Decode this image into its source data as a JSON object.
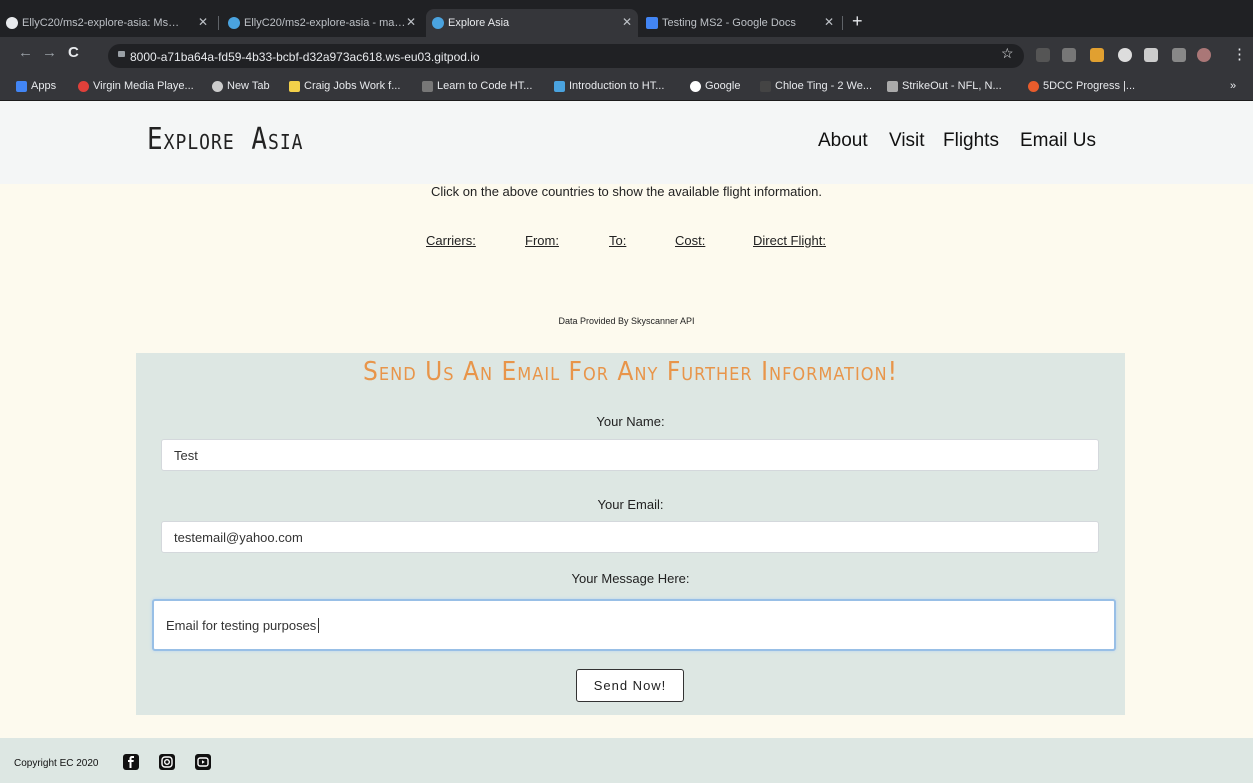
{
  "browser": {
    "tabs": [
      {
        "label": "EllyC20/ms2-explore-asia: Ms…",
        "icon": "github-icon"
      },
      {
        "label": "EllyC20/ms2-explore-asia - ma…",
        "icon": "gitpod-icon"
      },
      {
        "label": "Explore Asia",
        "icon": "gitpod-icon",
        "active": true
      },
      {
        "label": "Testing MS2 - Google Docs",
        "icon": "docs-icon"
      }
    ],
    "new_tab": "+",
    "url": "8000-a71ba64a-fd59-4b33-bcbf-d32a973ac618.ws-eu03.gitpod.io",
    "bookmarks": [
      "Apps",
      "Virgin Media Playe...",
      "New Tab",
      "Craig Jobs Work f...",
      "Learn to Code HT...",
      "Introduction to HT...",
      "Google",
      "Chloe Ting - 2 We...",
      "StrikeOut - NFL, N...",
      "5DCC Progress |..."
    ],
    "more_bookmarks": "»"
  },
  "header": {
    "logo": "Explore Asia",
    "nav": [
      "About",
      "Visit",
      "Flights",
      "Email Us"
    ]
  },
  "flights": {
    "instruction": "Click on the above countries to show the available flight information.",
    "columns": [
      "Carriers:",
      "From:",
      "To:",
      "Cost:",
      "Direct Flight:"
    ],
    "attribution": "Data Provided By Skyscanner API"
  },
  "contact": {
    "title": "Send Us An Email For Any Further Information!",
    "name_label": "Your Name:",
    "name_value": "Test",
    "email_label": "Your Email:",
    "email_value": "testemail@yahoo.com",
    "message_label": "Your Message Here:",
    "message_value": "Email for testing purposes",
    "submit_label": "Send Now!"
  },
  "footer": {
    "copyright": "Copyright EC 2020",
    "social": [
      "facebook-icon",
      "instagram-icon",
      "youtube-icon"
    ]
  }
}
